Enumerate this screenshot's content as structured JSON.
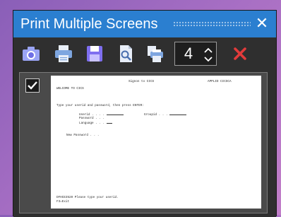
{
  "window": {
    "title": "Print Multiple Screens",
    "close_glyph": "✕"
  },
  "toolbar": {
    "buttons": [
      {
        "name": "camera-icon",
        "color": "#9a8cff"
      },
      {
        "name": "printer-icon",
        "color": "#bcd3f2"
      },
      {
        "name": "save-icon",
        "color": "#8a7cff"
      },
      {
        "name": "print-preview-icon",
        "color": "#cfd8e6"
      },
      {
        "name": "print-multiple-icon",
        "color": "#bcd3f2"
      },
      {
        "name": "cancel-icon",
        "color": "#e23b3b"
      }
    ],
    "copies_value": "4"
  },
  "screen": {
    "checked": true,
    "header_center": "Signon to CICS",
    "header_right": "APPLID CICSCA",
    "welcome": "WELCOME TO CICS",
    "prompt": "Type your userid and password, then press ENTER:",
    "userid_label": "Userid . . . .",
    "groupid_label": "Groupid . . .",
    "password_label": "Password . . .",
    "language_label": "Language . . .",
    "new_password_label": "New Password . . .",
    "message": "DFHCE3520 Please type your userid.",
    "f3_label": "F3=Exit"
  },
  "colors": {
    "titlebar": "#2b7fd0",
    "window_bg": "#2f2f2f",
    "desktop_gradient_start": "#8a5fb8"
  }
}
